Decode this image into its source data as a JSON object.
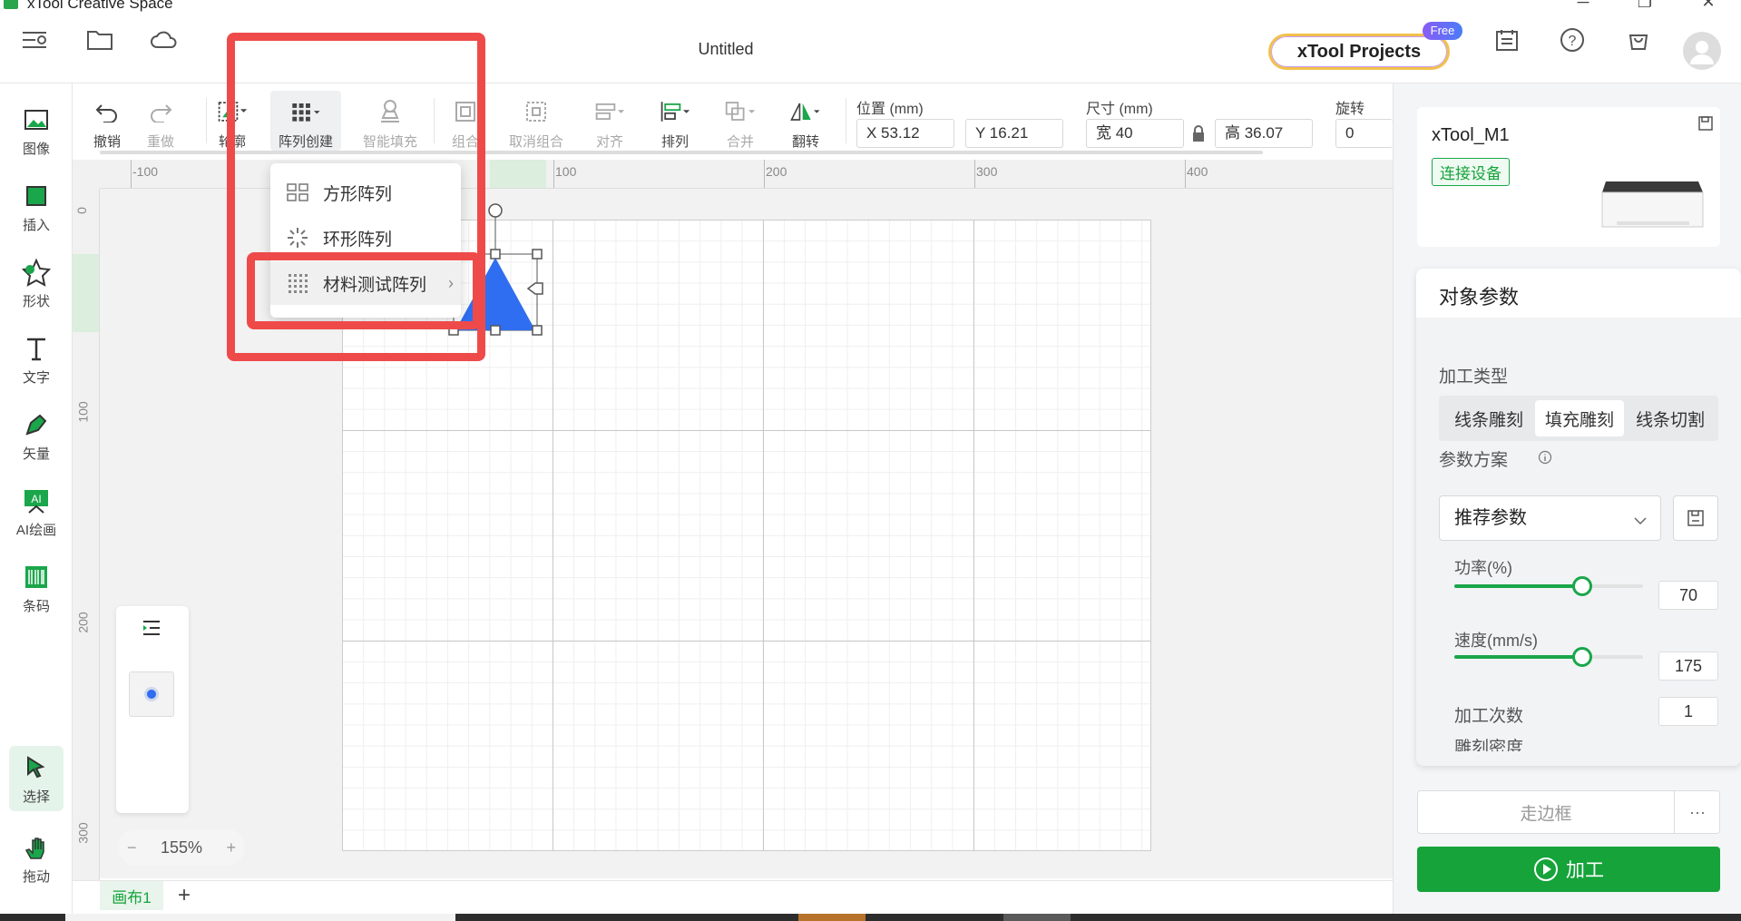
{
  "window": {
    "title": "xTool Creative Space",
    "doc_title": "Untitled"
  },
  "header": {
    "projects_label": "xTool Projects",
    "free_badge": "Free"
  },
  "leftbar": {
    "items": [
      {
        "label": "图像",
        "icon": "image-icon"
      },
      {
        "label": "插入",
        "icon": "insert-icon"
      },
      {
        "label": "形状",
        "icon": "star-icon"
      },
      {
        "label": "文字",
        "icon": "text-icon"
      },
      {
        "label": "矢量",
        "icon": "pen-icon"
      },
      {
        "label": "AI绘画",
        "icon": "ai-paint-icon"
      },
      {
        "label": "条码",
        "icon": "barcode-icon"
      }
    ],
    "select_label": "选择",
    "drag_label": "拖动"
  },
  "toolbar": {
    "undo": "撤销",
    "redo": "重做",
    "outline": "轮廓",
    "array": "阵列创建",
    "smart_fill": "智能填充",
    "group": "组合",
    "ungroup": "取消组合",
    "align": "对齐",
    "arrange": "排列",
    "merge": "合并",
    "flip": "翻转",
    "position_label": "位置 (mm)",
    "x_value": "X 53.12",
    "y_value": "Y 16.21",
    "size_label": "尺寸 (mm)",
    "width_value": "宽 40",
    "height_value": "高 36.07",
    "rotate_label": "旋转",
    "rotate_value": "0"
  },
  "ruler": {
    "h_ticks": [
      "-100",
      "100",
      "200",
      "300",
      "400"
    ],
    "v_ticks": [
      "0",
      "100",
      "200",
      "300"
    ]
  },
  "array_menu": {
    "items": [
      "方形阵列",
      "环形阵列",
      "材料测试阵列"
    ],
    "arrow": "›"
  },
  "zoom": {
    "value": "155%",
    "minus": "−",
    "plus": "+"
  },
  "canvas_tabs": {
    "tab": "画布1",
    "add": "+"
  },
  "device": {
    "name": "xTool_M1",
    "connect": "连接设备"
  },
  "params": {
    "title": "对象参数",
    "process_type_label": "加工类型",
    "process_types": [
      "线条雕刻",
      "填充雕刻",
      "线条切割"
    ],
    "selected_type": "填充雕刻",
    "scheme_label": "参数方案",
    "scheme_value": "推荐参数",
    "power_label": "功率(%)",
    "power_value": "70",
    "power_fraction": 0.68,
    "speed_label": "速度(mm/s)",
    "speed_value": "175",
    "speed_fraction": 0.68,
    "passes_label": "加工次数",
    "passes_value": "1",
    "cut_off_label": "雕刻密度"
  },
  "actions": {
    "frame": "走边框",
    "more": "···",
    "process": "加工"
  },
  "colors": {
    "accent": "#15a33a",
    "highlight": "#ef4a4a",
    "shape": "#2f6ef0"
  }
}
